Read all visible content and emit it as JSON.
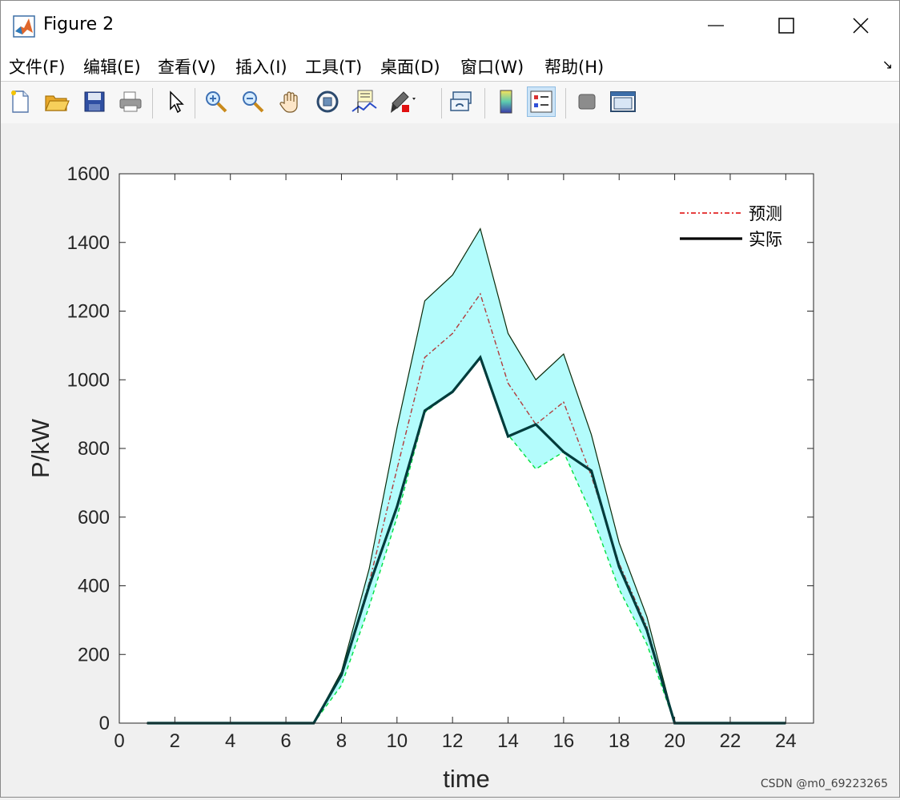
{
  "window": {
    "title": "Figure 2"
  },
  "menubar": {
    "items": [
      "文件(F)",
      "编辑(E)",
      "查看(V)",
      "插入(I)",
      "工具(T)",
      "桌面(D)",
      "窗口(W)",
      "帮助(H)"
    ]
  },
  "toolbar": {
    "buttons": [
      {
        "icon": "new-figure-icon"
      },
      {
        "icon": "open-file-icon"
      },
      {
        "icon": "save-icon"
      },
      {
        "icon": "print-icon"
      },
      {
        "icon": "edit-plot-arrow-icon"
      },
      {
        "icon": "zoom-in-icon"
      },
      {
        "icon": "zoom-out-icon"
      },
      {
        "icon": "pan-hand-icon"
      },
      {
        "icon": "rotate-3d-icon"
      },
      {
        "icon": "data-cursor-icon"
      },
      {
        "icon": "brush-icon"
      },
      {
        "icon": "link-plot-icon"
      },
      {
        "icon": "colorbar-icon"
      },
      {
        "icon": "legend-icon",
        "active": true
      },
      {
        "icon": "hide-plot-tools-icon"
      },
      {
        "icon": "show-plot-tools-icon"
      }
    ]
  },
  "watermark": "CSDN @m0_69223265",
  "chart_data": {
    "type": "line",
    "title": "",
    "xlabel": "time",
    "ylabel": "P/kW",
    "xlim": [
      0,
      25
    ],
    "ylim": [
      0,
      1600
    ],
    "xticks": [
      0,
      2,
      4,
      6,
      8,
      10,
      12,
      14,
      16,
      18,
      20,
      22,
      24
    ],
    "yticks": [
      0,
      200,
      400,
      600,
      800,
      1000,
      1200,
      1400,
      1600
    ],
    "grid": false,
    "legend_position": "top-right",
    "x": [
      1,
      2,
      3,
      4,
      5,
      6,
      7,
      8,
      9,
      10,
      11,
      12,
      13,
      14,
      15,
      16,
      17,
      18,
      19,
      20,
      21,
      22,
      23,
      24
    ],
    "band": {
      "fill": "#b3fcfc",
      "upper": [
        0,
        0,
        0,
        0,
        0,
        0,
        0,
        150,
        450,
        860,
        1230,
        1305,
        1440,
        1135,
        1000,
        1075,
        840,
        525,
        310,
        0,
        0,
        0,
        0,
        0
      ],
      "lower": [
        0,
        0,
        0,
        0,
        0,
        0,
        0,
        110,
        340,
        600,
        905,
        965,
        1065,
        840,
        740,
        790,
        610,
        390,
        230,
        0,
        0,
        0,
        0,
        0
      ]
    },
    "series": [
      {
        "name": "预测",
        "color": "#b23a3a",
        "style": "dashdot",
        "values": [
          0,
          0,
          0,
          0,
          0,
          0,
          0,
          140,
          410,
          740,
          1065,
          1135,
          1250,
          990,
          870,
          935,
          720,
          465,
          280,
          0,
          0,
          0,
          0,
          0
        ]
      },
      {
        "name": "实际",
        "color": "#003c3c",
        "style": "solid",
        "values": [
          0,
          0,
          0,
          0,
          0,
          0,
          0,
          140,
          400,
          630,
          910,
          965,
          1065,
          835,
          870,
          790,
          735,
          455,
          270,
          0,
          0,
          0,
          0,
          0
        ]
      }
    ],
    "legend": [
      {
        "label": "预测",
        "color": "#dd0000",
        "style": "dashdot"
      },
      {
        "label": "实际",
        "color": "#000000",
        "style": "solid"
      }
    ]
  }
}
